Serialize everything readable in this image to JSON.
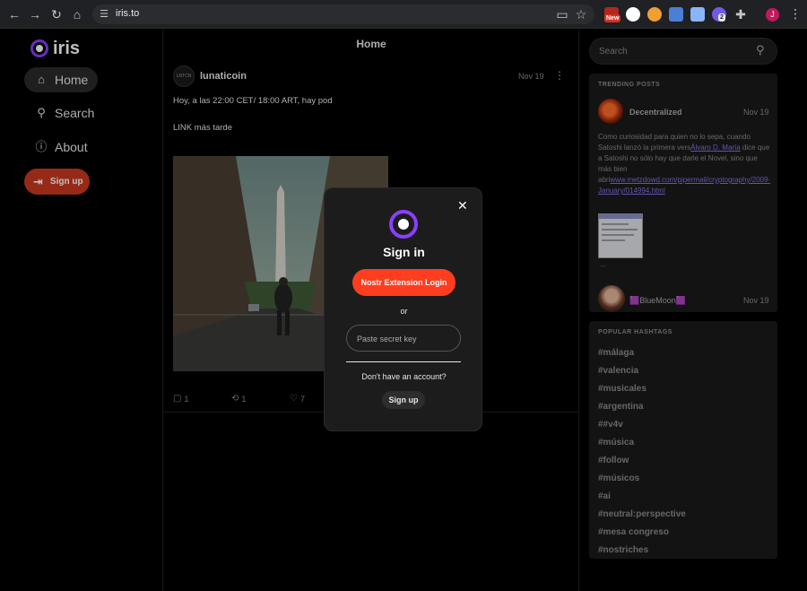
{
  "browser": {
    "url": "iris.to",
    "ext_new_badge": "New",
    "ext_count_badge": "2",
    "profile_initial": "J"
  },
  "sidebar": {
    "logo_text": "iris",
    "items": [
      {
        "label": "Home",
        "icon": "home-icon"
      },
      {
        "label": "Search",
        "icon": "search-icon"
      },
      {
        "label": "About",
        "icon": "info-icon"
      }
    ],
    "signup_label": "Sign up"
  },
  "main": {
    "title": "Home",
    "post": {
      "avatar_text": "LNTCN",
      "author": "lunaticoin",
      "date": "Nov 19",
      "text_line1": "Hoy, a las 22:00 CET/ 18:00 ART, hay pod",
      "text_line2": "LINK más tarde",
      "replies": "1",
      "reposts": "1",
      "likes": "7"
    }
  },
  "right": {
    "search_placeholder": "Search",
    "trending": {
      "title": "TRENDING POSTS",
      "post1": {
        "author": "Decentralized",
        "date": "Nov 19",
        "text_a": "Como curiosidad para quien no lo sepa, cuando Satoshi lanzó la primera vers",
        "link_a": "Álvaro D. María",
        "text_b": "  dice que a Satoshi no sólo hay que darle el Novel, sino que más bien abri",
        "link_b": "www.metzdowd.com/pipermail/cryptography/2009-January/014994.html",
        "ellipsis": "..."
      },
      "post2": {
        "author": "🟪BlueMoon🟪",
        "date": "Nov 19"
      }
    },
    "hashtags": {
      "title": "POPULAR HASHTAGS",
      "items": [
        "#málaga",
        "#valencia",
        "#musicales",
        "#argentina",
        "##v4v",
        "#música",
        "#follow",
        "#músicos",
        "#ai",
        "#neutral:perspective",
        "#mesa congreso",
        "#nostriches"
      ]
    }
  },
  "modal": {
    "title": "Sign in",
    "primary_label": "Nostr Extension Login",
    "or_label": "or",
    "input_placeholder": "Paste secret key",
    "question": "Don't have an account?",
    "signup_label": "Sign up"
  },
  "colors": {
    "brand": "#8a3ffc",
    "cta": "#ff3d1f",
    "background": "#000000"
  }
}
